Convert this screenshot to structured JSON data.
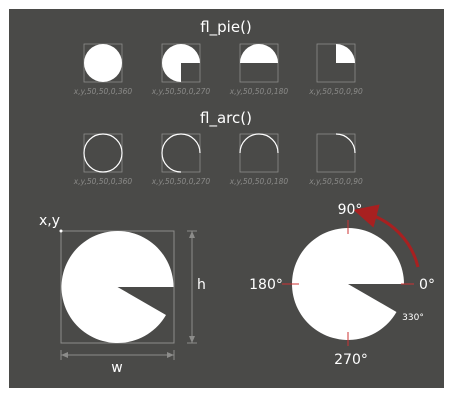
{
  "pie_section": {
    "title": "fl_pie()",
    "items": [
      {
        "label": "x,y,50,50,0,360",
        "a1": 0,
        "a2": 360
      },
      {
        "label": "x,y,50,50,0,270",
        "a1": 0,
        "a2": 270
      },
      {
        "label": "x,y,50,50,0,180",
        "a1": 0,
        "a2": 180
      },
      {
        "label": "x,y,50,50,0,90",
        "a1": 0,
        "a2": 90
      }
    ]
  },
  "arc_section": {
    "title": "fl_arc()",
    "items": [
      {
        "label": "x,y,50,50,0,360",
        "a1": 0,
        "a2": 360
      },
      {
        "label": "x,y,50,50,0,270",
        "a1": 0,
        "a2": 270
      },
      {
        "label": "x,y,50,50,0,180",
        "a1": 0,
        "a2": 180
      },
      {
        "label": "x,y,50,50,0,90",
        "a1": 0,
        "a2": 90
      }
    ]
  },
  "bounding_diagram": {
    "origin_label": "x,y",
    "width_label": "w",
    "height_label": "h",
    "pie_start_angle": 0,
    "pie_end_angle": 330
  },
  "angle_diagram": {
    "label_90": "90°",
    "label_180": "180°",
    "label_0": "0°",
    "label_270": "270°",
    "label_330": "330°",
    "pie_start_angle": 0,
    "pie_end_angle": 330,
    "direction": "counter-clockwise"
  },
  "colors": {
    "background": "#4a4a48",
    "shape": "#ffffff",
    "box": "#8c8c8a",
    "caption": "#8a8a88",
    "tick": "#cc3333",
    "arrow": "#a82020"
  }
}
